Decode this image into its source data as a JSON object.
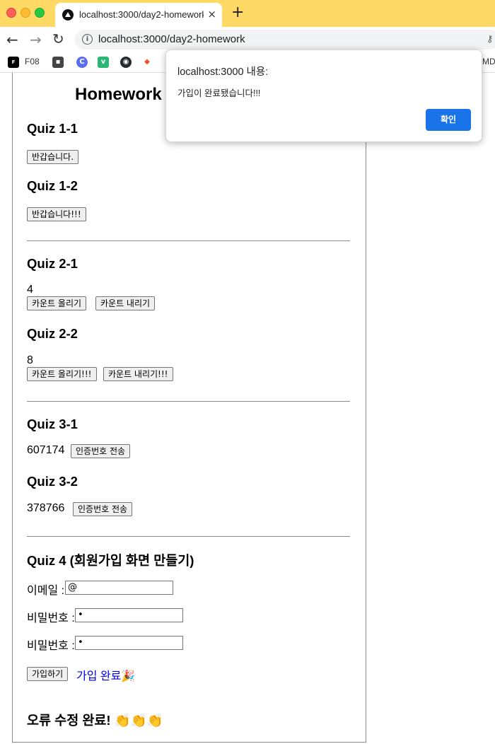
{
  "browser": {
    "tab_title": "localhost:3000/day2-homework",
    "tab_close": "×",
    "new_tab": "+",
    "url": "localhost:3000/day2-homework",
    "bookmarks": [
      "F08",
      "MD"
    ]
  },
  "page": {
    "title": "Homework",
    "quiz1_1": {
      "heading": "Quiz 1-1",
      "button": "반갑습니다."
    },
    "quiz1_2": {
      "heading": "Quiz 1-2",
      "button": "반갑습니다!!!"
    },
    "quiz2_1": {
      "heading": "Quiz 2-1",
      "count": "4",
      "up": "카운트 올리기",
      "down": "카운트 내리기"
    },
    "quiz2_2": {
      "heading": "Quiz 2-2",
      "count": "8",
      "up": "카운트 올리기!!!",
      "down": "카운트 내리기!!!"
    },
    "quiz3_1": {
      "heading": "Quiz 3-1",
      "code": "607174",
      "button": "인증번호 전송"
    },
    "quiz3_2": {
      "heading": "Quiz 3-2",
      "code": "378766",
      "button": "인증번호 전송"
    },
    "quiz4": {
      "heading": "Quiz 4 (회원가입 화면 만들기)",
      "email_label": "이메일 :",
      "email_value": "@",
      "password_label": "비밀번호 :",
      "password_value": "•",
      "password2_label": "비밀번호 :",
      "password2_value": "•",
      "signup_button": "가입하기",
      "done_text": "가입 완료🎉"
    },
    "footer": "오류 수정 완료! 👏👏👏"
  },
  "dialog": {
    "title": "localhost:3000 내용:",
    "message": "가입이 완료됐습니다!!!",
    "ok_label": "확인"
  }
}
